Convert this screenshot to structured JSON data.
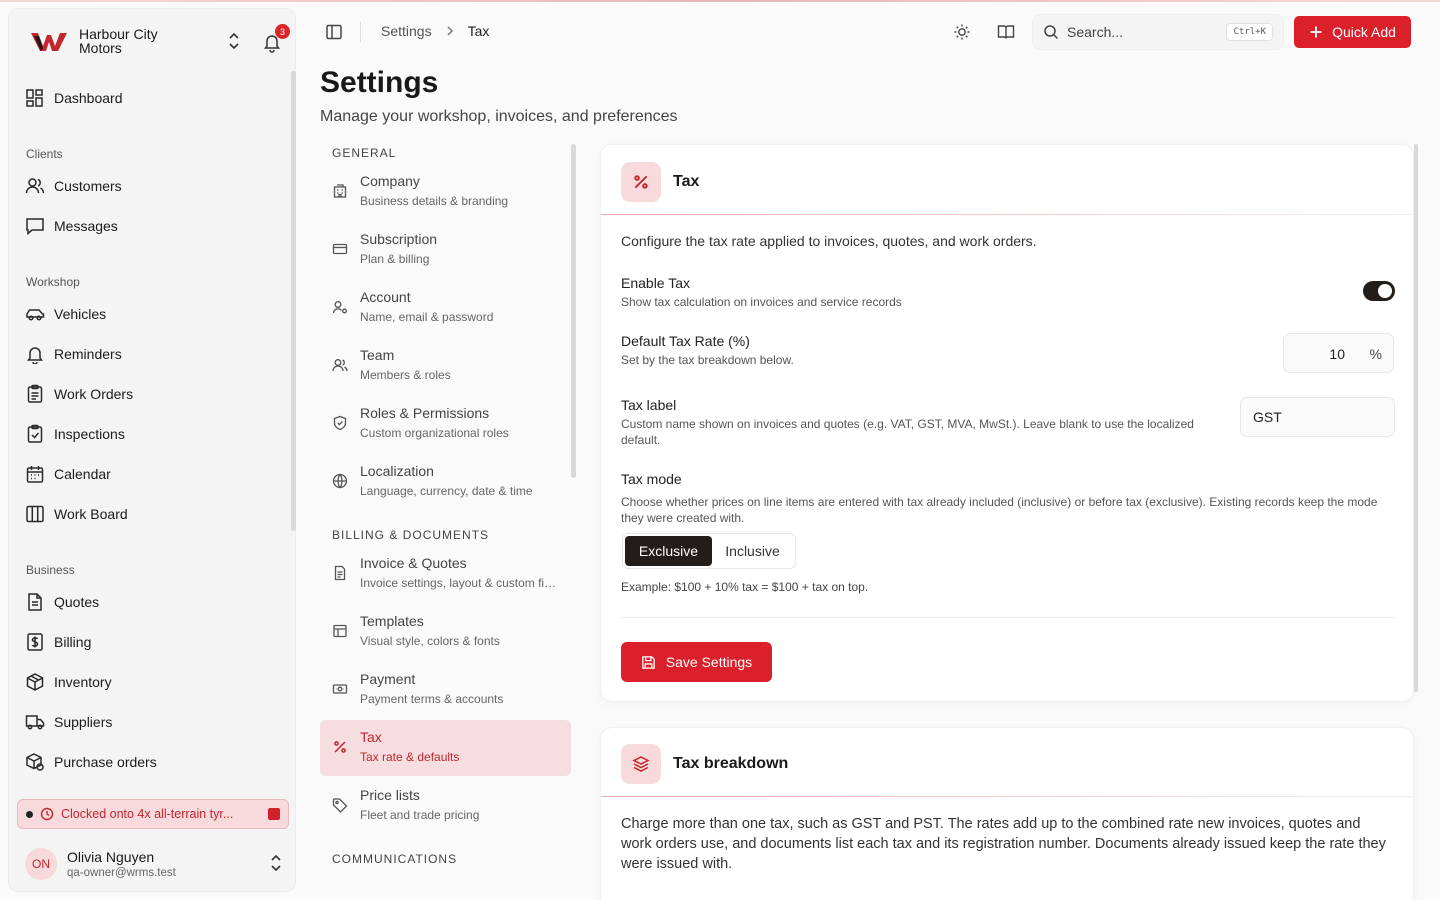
{
  "brand": {
    "name": "Harbour City Motors",
    "notification_count": "3"
  },
  "sidebar": {
    "top_items": [
      {
        "label": "Dashboard",
        "icon": "dashboard-icon"
      }
    ],
    "groups": [
      {
        "label": "Clients",
        "items": [
          {
            "label": "Customers",
            "icon": "users-icon"
          },
          {
            "label": "Messages",
            "icon": "message-icon"
          }
        ]
      },
      {
        "label": "Workshop",
        "items": [
          {
            "label": "Vehicles",
            "icon": "car-icon"
          },
          {
            "label": "Reminders",
            "icon": "bell-icon"
          },
          {
            "label": "Work Orders",
            "icon": "clipboard-icon"
          },
          {
            "label": "Inspections",
            "icon": "clipboard-check-icon"
          },
          {
            "label": "Calendar",
            "icon": "calendar-icon"
          },
          {
            "label": "Work Board",
            "icon": "board-icon"
          }
        ]
      },
      {
        "label": "Business",
        "items": [
          {
            "label": "Quotes",
            "icon": "document-icon"
          },
          {
            "label": "Billing",
            "icon": "dollar-icon"
          },
          {
            "label": "Inventory",
            "icon": "box-icon"
          },
          {
            "label": "Suppliers",
            "icon": "truck-icon"
          },
          {
            "label": "Purchase orders",
            "icon": "package-icon"
          }
        ]
      }
    ],
    "clock_banner": "Clocked onto 4x all-terrain tyr...",
    "user": {
      "initials": "ON",
      "name": "Olivia Nguyen",
      "email": "qa-owner@wrms.test"
    }
  },
  "topbar": {
    "breadcrumb": [
      "Settings",
      "Tax"
    ],
    "search_placeholder": "Search...",
    "search_shortcut": "Ctrl+K",
    "quick_add": "Quick Add"
  },
  "page": {
    "title": "Settings",
    "subtitle": "Manage your workshop, invoices, and preferences"
  },
  "settings_nav": {
    "general_heading": "GENERAL",
    "general": [
      {
        "title": "Company",
        "sub": "Business details & branding",
        "icon": "building-icon"
      },
      {
        "title": "Subscription",
        "sub": "Plan & billing",
        "icon": "credit-card-icon"
      },
      {
        "title": "Account",
        "sub": "Name, email & password",
        "icon": "user-settings-icon"
      },
      {
        "title": "Team",
        "sub": "Members & roles",
        "icon": "team-icon"
      },
      {
        "title": "Roles & Permissions",
        "sub": "Custom organizational roles",
        "icon": "shield-icon"
      },
      {
        "title": "Localization",
        "sub": "Language, currency, date & time",
        "icon": "globe-icon"
      }
    ],
    "billing_heading": "BILLING & DOCUMENTS",
    "billing": [
      {
        "title": "Invoice & Quotes",
        "sub": "Invoice settings, layout & custom fields",
        "icon": "invoice-icon"
      },
      {
        "title": "Templates",
        "sub": "Visual style, colors & fonts",
        "icon": "layout-icon"
      },
      {
        "title": "Payment",
        "sub": "Payment terms & accounts",
        "icon": "cash-icon"
      },
      {
        "title": "Tax",
        "sub": "Tax rate & defaults",
        "icon": "percent-icon",
        "active": true
      },
      {
        "title": "Price lists",
        "sub": "Fleet and trade pricing",
        "icon": "tag-icon"
      }
    ],
    "communications_heading": "COMMUNICATIONS"
  },
  "tax_card": {
    "title": "Tax",
    "description": "Configure the tax rate applied to invoices, quotes, and work orders.",
    "enable": {
      "label": "Enable Tax",
      "help": "Show tax calculation on invoices and service records",
      "on": true
    },
    "rate": {
      "label": "Default Tax Rate (%)",
      "help": "Set by the tax breakdown below.",
      "value": "10",
      "unit": "%"
    },
    "tax_label": {
      "label": "Tax label",
      "help": "Custom name shown on invoices and quotes (e.g. VAT, GST, MVA, MwSt.). Leave blank to use the localized default.",
      "value": "GST"
    },
    "mode": {
      "label": "Tax mode",
      "help": "Choose whether prices on line items are entered with tax already included (inclusive) or before tax (exclusive). Existing records keep the mode they were created with.",
      "options": [
        "Exclusive",
        "Inclusive"
      ],
      "selected": "Exclusive",
      "example": "Example: $100 + 10% tax = $100 + tax on top."
    },
    "save_label": "Save Settings"
  },
  "breakdown_card": {
    "title": "Tax breakdown",
    "description": "Charge more than one tax, such as GST and PST. The rates add up to the combined rate new invoices, quotes and work orders use, and documents list each tax and its registration number. Documents already issued keep the rate they were issued with."
  },
  "colors": {
    "accent": "#d9202b",
    "accent_soft": "#f8dadd",
    "dark": "#231d19"
  }
}
